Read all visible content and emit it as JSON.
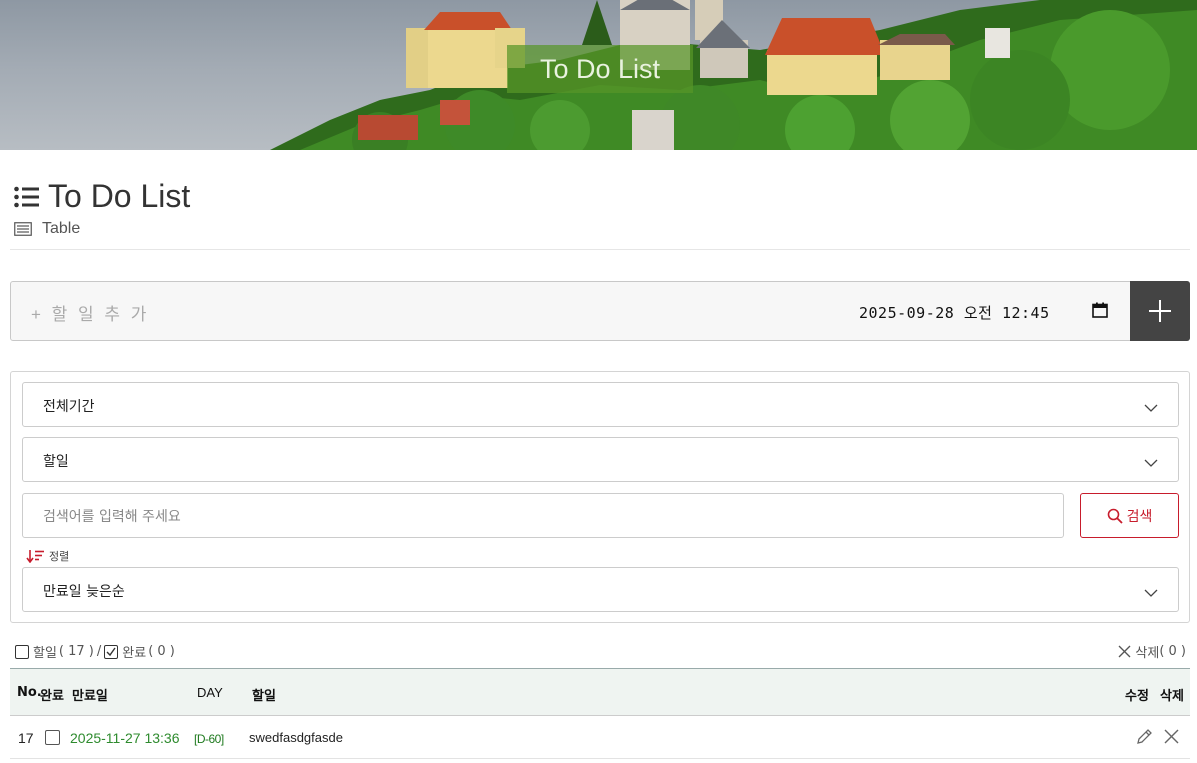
{
  "banner": {
    "title": "To Do List"
  },
  "header": {
    "title": "To Do List",
    "view_label": "Table"
  },
  "add_bar": {
    "placeholder": "+ 할 일 추 가",
    "datetime": "2025-09-28 오전 12:45",
    "add_icon": "plus-icon"
  },
  "filters": {
    "period": "전체기간",
    "target": "할일",
    "search_placeholder": "검색어를 입력해 주세요",
    "search_button": "검색",
    "sort_label": "정렬",
    "sort_value": "만료일 늦은순"
  },
  "summary": {
    "todo_label": "할일",
    "todo_count": "( 17 )",
    "separator": "/",
    "done_label": "완료",
    "done_count": "( 0 )",
    "delete_label": "삭제",
    "delete_count": "( 0 )"
  },
  "table": {
    "headers": {
      "no": "No.",
      "done": "완료",
      "due": "만료일",
      "day": "DAY",
      "task": "할일",
      "edit": "수정",
      "delete": "삭제"
    },
    "rows": [
      {
        "no": "17",
        "due": "2025-11-27 13:36",
        "day": "[D-60]",
        "task": "swedfasdgfasde",
        "done": false
      }
    ]
  },
  "colors": {
    "accent_red": "#c71c2c",
    "due_green": "#2e8b2e",
    "dark_button": "#444444",
    "banner_label_bg": "#5a9628"
  }
}
